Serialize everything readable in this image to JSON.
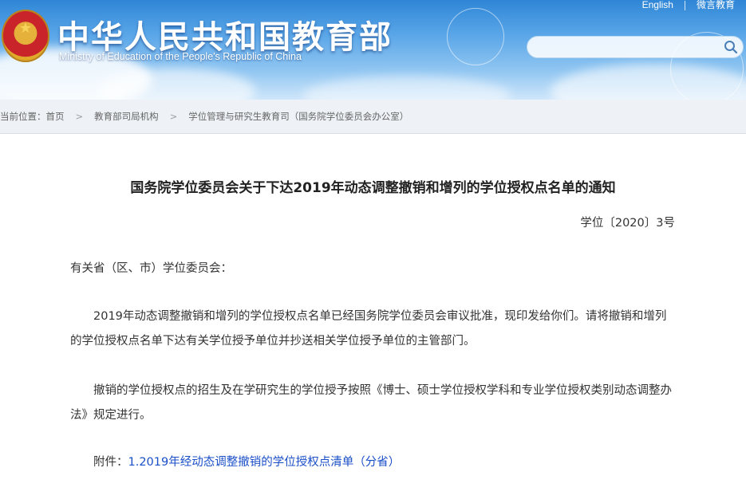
{
  "header": {
    "title_cn": "中华人民共和国教育部",
    "title_en": "Ministry of Education of the People's Republic of China",
    "links": {
      "english": "English",
      "weibo": "微言教育"
    },
    "search": {
      "placeholder": "",
      "icon": "search-icon"
    },
    "emblem": "national-emblem-icon",
    "colors": {
      "sky_top": "#2f86d6",
      "sky_bottom": "#cfe6fa"
    }
  },
  "breadcrumb": {
    "label": "当前位置：",
    "items": [
      "首页",
      "教育部司局机构",
      "学位管理与研究生教育司（国务院学位委员会办公室）"
    ],
    "separator": ">"
  },
  "article": {
    "title": "国务院学位委员会关于下达2019年动态调整撤销和增列的学位授权点名单的通知",
    "doc_number": "学位〔2020〕3号",
    "salutation": "有关省（区、市）学位委员会：",
    "paragraphs": [
      "2019年动态调整撤销和增列的学位授权点名单已经国务院学位委员会审议批准，现印发给你们。请将撤销和增列的学位授权点名单下达有关学位授予单位并抄送相关学位授予单位的主管部门。",
      "撤销的学位授权点的招生及在学研究生的学位授予按照《博士、硕士学位授权学科和专业学位授权类别动态调整办法》规定进行。"
    ],
    "attachment_label": "附件：",
    "attachment_link": "1.2019年经动态调整撤销的学位授权点清单（分省）",
    "link_color": "#1a4fc8"
  }
}
